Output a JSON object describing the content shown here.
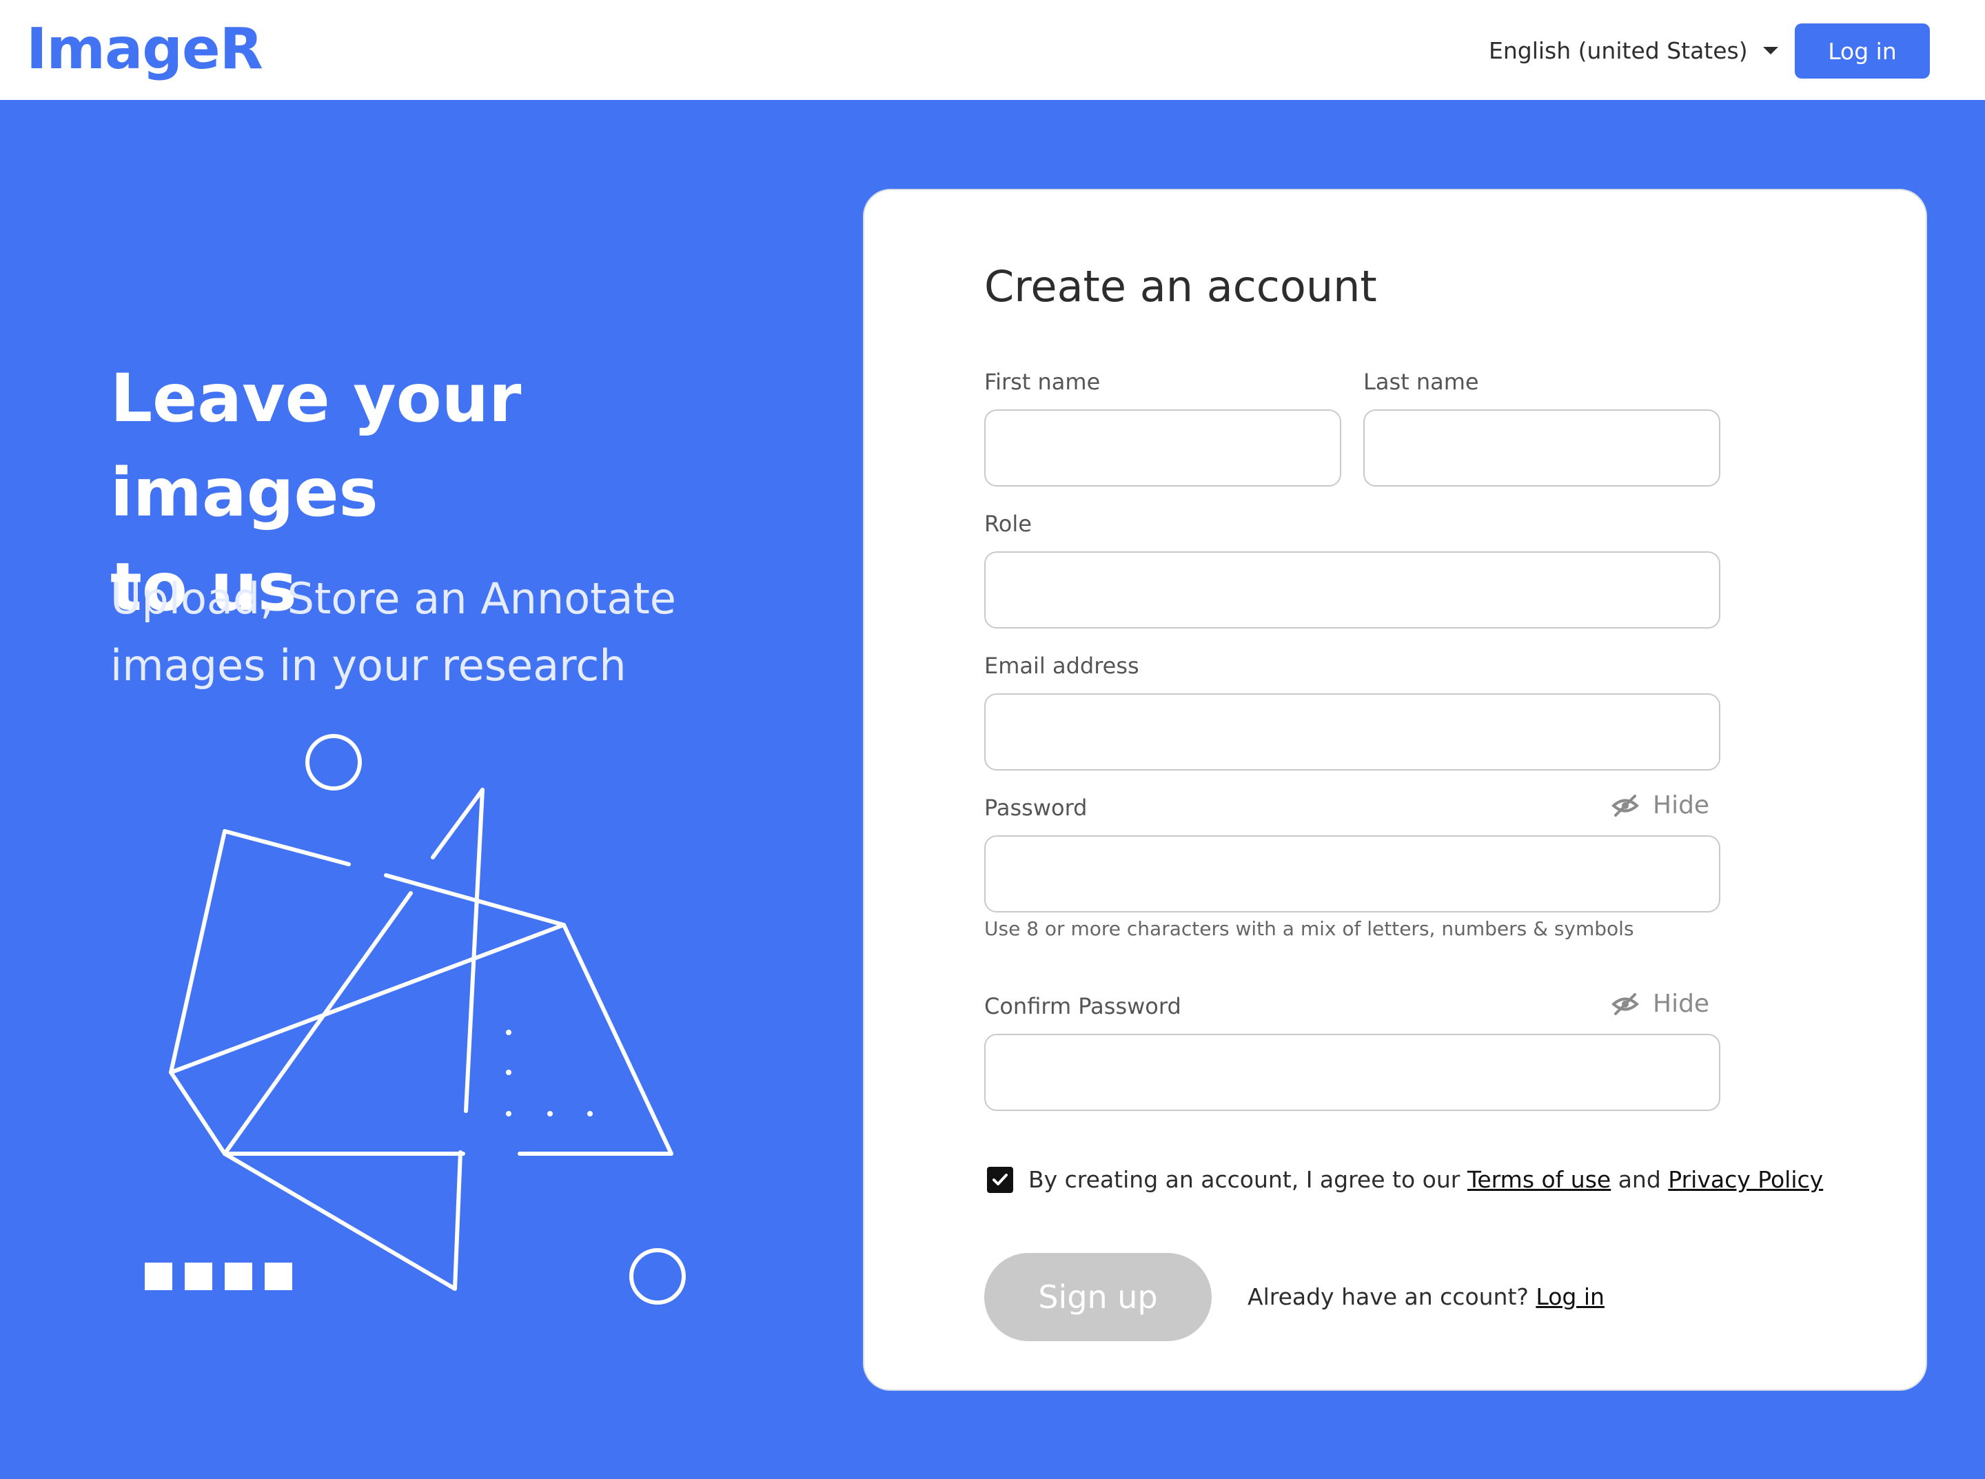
{
  "header": {
    "logo": "ImageR",
    "language": "English (united States)",
    "login_label": "Log in"
  },
  "hero": {
    "title_line1": "Leave your images",
    "title_line2": "to us",
    "subtitle_line1": "Upload, Store an Annotate",
    "subtitle_line2": "images in your research"
  },
  "form": {
    "title": "Create an account",
    "first_name": {
      "label": "First name",
      "value": ""
    },
    "last_name": {
      "label": "Last name",
      "value": ""
    },
    "role": {
      "label": "Role",
      "value": ""
    },
    "email": {
      "label": "Email address",
      "value": ""
    },
    "password": {
      "label": "Password",
      "value": "",
      "toggle": "Hide"
    },
    "password_hint": "Use 8 or more characters with a mix of letters, numbers & symbols",
    "confirm_password": {
      "label": "Confirm Password",
      "value": "",
      "toggle": "Hide"
    },
    "agree": {
      "checked": true,
      "prefix": "By creating an account, I agree to our ",
      "terms": "Terms of use",
      "and": " and ",
      "privacy": "Privacy Policy"
    },
    "signup_label": "Sign up",
    "already_text": "Already have an ccount? ",
    "already_link": "Log in"
  },
  "colors": {
    "brand": "#4273f3",
    "disabled_button": "#c9c9c9"
  },
  "icons": [
    "caret-down-icon",
    "eye-slash-icon",
    "checkmark-icon"
  ]
}
